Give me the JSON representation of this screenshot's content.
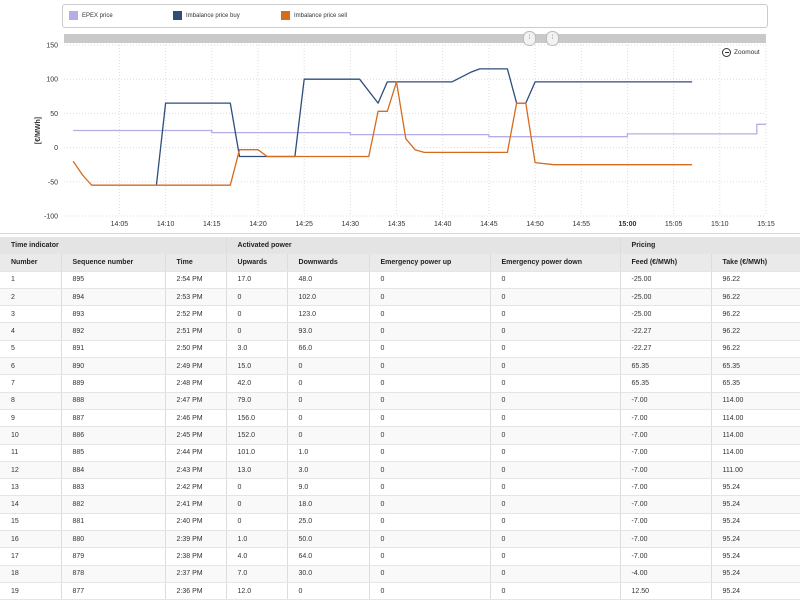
{
  "legend": {
    "epex_label": "EPEX price",
    "buy_label": "Imbalance price buy",
    "sell_label": "Imbalance price sell"
  },
  "zoomout_label": "Zoomout",
  "colors": {
    "epex": "#b6ade6",
    "buy": "#2e4d7c",
    "sell": "#d66b1e",
    "grid": "#dddddd"
  },
  "chart_data": {
    "type": "line",
    "ylabel": "[€/MWh]",
    "ylim": [
      -100,
      150
    ],
    "yticks": [
      150,
      100,
      50,
      0,
      -50,
      -100
    ],
    "xlim": [
      "13:59",
      "15:15"
    ],
    "xticks": [
      "14:05",
      "14:10",
      "14:15",
      "14:20",
      "14:25",
      "14:30",
      "14:35",
      "14:40",
      "14:45",
      "14:50",
      "14:55",
      "15:00",
      "15:05",
      "15:10",
      "15:15"
    ],
    "xticks_bold": [
      "15:00"
    ],
    "grid": true,
    "legend_position": "top",
    "series": [
      {
        "name": "EPEX price",
        "key": "epex",
        "points": [
          [
            "14:00",
            25
          ],
          [
            "14:15",
            25
          ],
          [
            "14:15",
            22
          ],
          [
            "14:30",
            22
          ],
          [
            "14:30",
            19
          ],
          [
            "14:45",
            19
          ],
          [
            "14:45",
            16
          ],
          [
            "15:00",
            16
          ],
          [
            "15:00",
            20
          ],
          [
            "15:14",
            20
          ],
          [
            "15:14",
            34
          ],
          [
            "15:15",
            34
          ]
        ]
      },
      {
        "name": "Imbalance price buy",
        "key": "buy",
        "points": [
          [
            "14:09",
            -55
          ],
          [
            "14:10",
            65
          ],
          [
            "14:17",
            65
          ],
          [
            "14:18",
            -13
          ],
          [
            "14:24",
            -13
          ],
          [
            "14:25",
            100
          ],
          [
            "14:31",
            100
          ],
          [
            "14:33",
            65
          ],
          [
            "14:34",
            96
          ],
          [
            "14:41",
            96
          ],
          [
            "14:43",
            110
          ],
          [
            "14:44",
            115
          ],
          [
            "14:47",
            115
          ],
          [
            "14:48",
            65
          ],
          [
            "14:49",
            65
          ],
          [
            "14:50",
            96
          ],
          [
            "15:07",
            96
          ]
        ]
      },
      {
        "name": "Imbalance price sell",
        "key": "sell",
        "points": [
          [
            "14:00",
            -20
          ],
          [
            "14:01",
            -40
          ],
          [
            "14:02",
            -55
          ],
          [
            "14:17",
            -55
          ],
          [
            "14:18",
            -3
          ],
          [
            "14:19",
            -3
          ],
          [
            "14:20",
            -3
          ],
          [
            "14:21",
            -13
          ],
          [
            "14:32",
            -13
          ],
          [
            "14:33",
            53
          ],
          [
            "14:34",
            53
          ],
          [
            "14:35",
            96
          ],
          [
            "14:36",
            13
          ],
          [
            "14:37",
            -3
          ],
          [
            "14:38",
            -7
          ],
          [
            "14:47",
            -7
          ],
          [
            "14:48",
            65
          ],
          [
            "14:49",
            65
          ],
          [
            "14:50",
            -22
          ],
          [
            "14:52",
            -25
          ],
          [
            "15:07",
            -25
          ]
        ]
      }
    ]
  },
  "table": {
    "groups": [
      {
        "label": "Time indicator",
        "span": 3
      },
      {
        "label": "Activated power",
        "span": 4
      },
      {
        "label": "Pricing",
        "span": 2
      }
    ],
    "columns": [
      "Number",
      "Sequence number",
      "Time",
      "Upwards",
      "Downwards",
      "Emergency power up",
      "Emergency power down",
      "Feed (€/MWh)",
      "Take (€/MWh)"
    ],
    "rows": [
      [
        "1",
        "895",
        "2:54 PM",
        "17.0",
        "48.0",
        "0",
        "0",
        "-25.00",
        "96.22"
      ],
      [
        "2",
        "894",
        "2:53 PM",
        "0",
        "102.0",
        "0",
        "0",
        "-25.00",
        "96.22"
      ],
      [
        "3",
        "893",
        "2:52 PM",
        "0",
        "123.0",
        "0",
        "0",
        "-25.00",
        "96.22"
      ],
      [
        "4",
        "892",
        "2:51 PM",
        "0",
        "93.0",
        "0",
        "0",
        "-22.27",
        "96.22"
      ],
      [
        "5",
        "891",
        "2:50 PM",
        "3.0",
        "66.0",
        "0",
        "0",
        "-22.27",
        "96.22"
      ],
      [
        "6",
        "890",
        "2:49 PM",
        "15.0",
        "0",
        "0",
        "0",
        "65.35",
        "65.35"
      ],
      [
        "7",
        "889",
        "2:48 PM",
        "42.0",
        "0",
        "0",
        "0",
        "65.35",
        "65.35"
      ],
      [
        "8",
        "888",
        "2:47 PM",
        "79.0",
        "0",
        "0",
        "0",
        "-7.00",
        "114.00"
      ],
      [
        "9",
        "887",
        "2:46 PM",
        "156.0",
        "0",
        "0",
        "0",
        "-7.00",
        "114.00"
      ],
      [
        "10",
        "886",
        "2:45 PM",
        "152.0",
        "0",
        "0",
        "0",
        "-7.00",
        "114.00"
      ],
      [
        "11",
        "885",
        "2:44 PM",
        "101.0",
        "1.0",
        "0",
        "0",
        "-7.00",
        "114.00"
      ],
      [
        "12",
        "884",
        "2:43 PM",
        "13.0",
        "3.0",
        "0",
        "0",
        "-7.00",
        "111.00"
      ],
      [
        "13",
        "883",
        "2:42 PM",
        "0",
        "9.0",
        "0",
        "0",
        "-7.00",
        "95.24"
      ],
      [
        "14",
        "882",
        "2:41 PM",
        "0",
        "18.0",
        "0",
        "0",
        "-7.00",
        "95.24"
      ],
      [
        "15",
        "881",
        "2:40 PM",
        "0",
        "25.0",
        "0",
        "0",
        "-7.00",
        "95.24"
      ],
      [
        "16",
        "880",
        "2:39 PM",
        "1.0",
        "50.0",
        "0",
        "0",
        "-7.00",
        "95.24"
      ],
      [
        "17",
        "879",
        "2:38 PM",
        "4.0",
        "64.0",
        "0",
        "0",
        "-7.00",
        "95.24"
      ],
      [
        "18",
        "878",
        "2:37 PM",
        "7.0",
        "30.0",
        "0",
        "0",
        "-4.00",
        "95.24"
      ],
      [
        "19",
        "877",
        "2:36 PM",
        "12.0",
        "0",
        "0",
        "0",
        "12.50",
        "95.24"
      ]
    ]
  }
}
